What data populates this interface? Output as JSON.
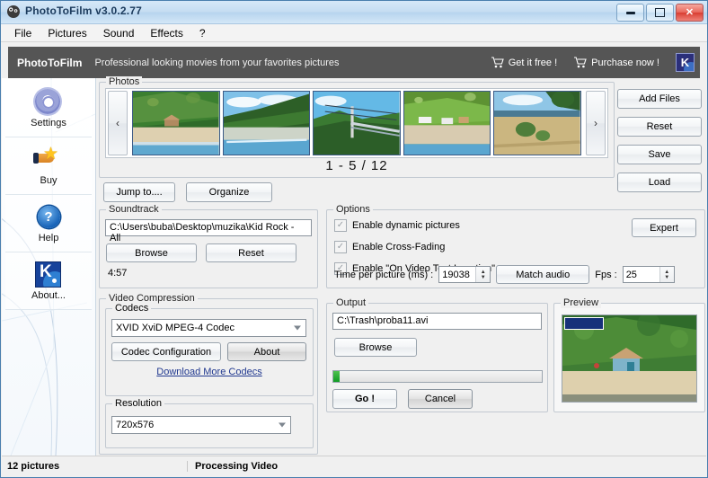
{
  "window": {
    "title": "PhotoToFilm v3.0.2.77",
    "icon": "app-icon",
    "minimize": "minimize",
    "maximize": "maximize",
    "close": "✕"
  },
  "menu": {
    "items": [
      "File",
      "Pictures",
      "Sound",
      "Effects",
      "?"
    ]
  },
  "banner": {
    "brand": "PhotoToFilm",
    "tagline": "Professional looking movies from your favorites pictures",
    "links": [
      {
        "label": "Get it free !",
        "icon": "cart-icon"
      },
      {
        "label": "Purchase now !",
        "icon": "cart-icon"
      }
    ],
    "logo_letter": "K"
  },
  "sidebar": {
    "items": [
      {
        "label": "Settings",
        "icon": "gear-icon"
      },
      {
        "label": "Buy",
        "icon": "star-hand-icon"
      },
      {
        "label": "Help",
        "icon": "question-icon"
      },
      {
        "label": "About...",
        "icon": "k-logo-icon"
      }
    ]
  },
  "photos": {
    "legend": "Photos",
    "prev": "‹",
    "next": "›",
    "counter": "1 - 5 / 12",
    "jump_to": "Jump to....",
    "organize": "Organize",
    "thumbnails": [
      "hillside-house-beach",
      "forest-ridge-river",
      "power-lines-bridge",
      "green-hill-houses",
      "dry-field-trees"
    ]
  },
  "file_buttons": [
    "Add Files",
    "Reset",
    "Save",
    "Load"
  ],
  "soundtrack": {
    "legend": "Soundtrack",
    "path": "C:\\Users\\buba\\Desktop\\muzika\\Kid Rock - All",
    "browse": "Browse",
    "reset": "Reset",
    "duration": "4:57"
  },
  "video_compression": {
    "legend": "Video Compression",
    "codecs_legend": "Codecs",
    "codec_selected": "XVID XviD MPEG-4 Codec",
    "codec_configuration": "Codec Configuration",
    "about": "About",
    "download_link": "Download More Codecs",
    "resolution_legend": "Resolution",
    "resolution_selected": "720x576"
  },
  "options": {
    "legend": "Options",
    "checkboxes": [
      {
        "label": "Enable dynamic pictures",
        "checked": true
      },
      {
        "label": "Enable Cross-Fading",
        "checked": true
      },
      {
        "label": "Enable \"On Video Text Insertion\"",
        "checked": true
      }
    ],
    "expert": "Expert",
    "time_label": "Time per picture (ms) :",
    "time_value": "19038",
    "match_audio": "Match audio",
    "fps_label": "Fps :",
    "fps_value": "25"
  },
  "output": {
    "legend": "Output",
    "path": "C:\\Trash\\proba11.avi",
    "browse": "Browse",
    "progress_percent": 3,
    "go": "Go !",
    "cancel": "Cancel"
  },
  "preview": {
    "legend": "Preview",
    "image": "green-hillside-house"
  },
  "status": {
    "left": "12 pictures",
    "right": "Processing Video"
  },
  "colors": {
    "banner_bg": "#555555",
    "accent_blue": "#17439b",
    "progress_green": "#0f9b23",
    "link": "#20388f"
  }
}
